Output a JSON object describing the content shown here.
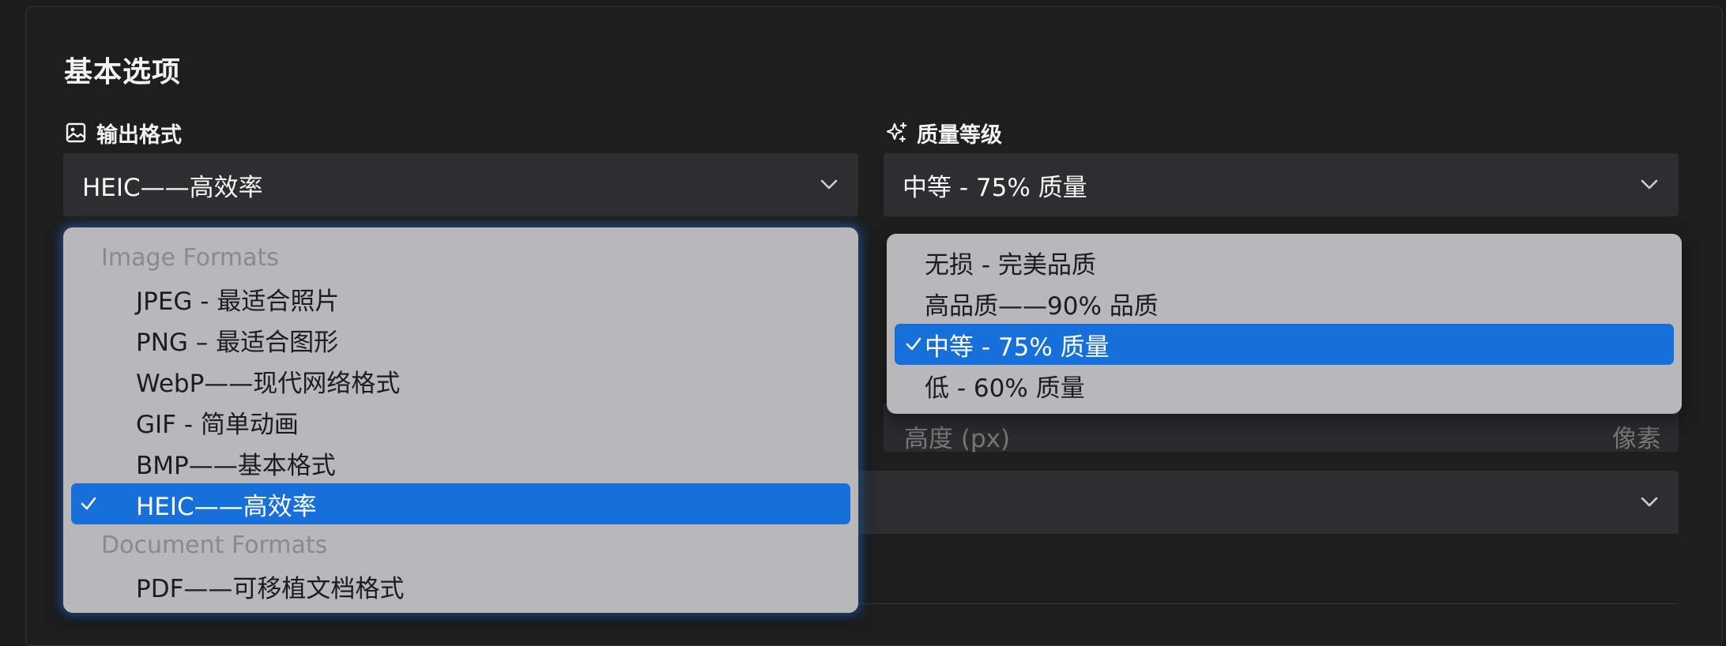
{
  "section_title": "基本选项",
  "output_format": {
    "label": "输出格式",
    "icon": "image-icon",
    "value": "HEIC——高效率",
    "menu": {
      "groups": [
        {
          "header": "Image Formats",
          "items": [
            {
              "label": "JPEG - 最适合照片",
              "selected": false
            },
            {
              "label": "PNG – 最适合图形",
              "selected": false
            },
            {
              "label": "WebP——现代网络格式",
              "selected": false
            },
            {
              "label": "GIF - 简单动画",
              "selected": false
            },
            {
              "label": "BMP——基本格式",
              "selected": false
            },
            {
              "label": "HEIC——高效率",
              "selected": true
            }
          ]
        },
        {
          "header": "Document Formats",
          "items": [
            {
              "label": "PDF——可移植文档格式",
              "selected": false
            }
          ]
        }
      ]
    }
  },
  "quality_level": {
    "label": "质量等级",
    "icon": "sparkle-icon",
    "value": "中等 - 75% 质量",
    "menu": {
      "items": [
        {
          "label": "无损 - 完美品质",
          "selected": false
        },
        {
          "label": "高品质——90% 品质",
          "selected": false
        },
        {
          "label": "中等 - 75% 质量",
          "selected": true
        },
        {
          "label": "低 - 60% 质量",
          "selected": false
        }
      ]
    }
  },
  "height_field": {
    "placeholder": "高度 (px)",
    "unit": "像素"
  },
  "colors": {
    "background": "#1e1e1f",
    "field_bg": "#2e2e30",
    "menu_bg": "#b8b8ba",
    "selected": "#176fd9",
    "focus_glow": "#2878e6"
  }
}
